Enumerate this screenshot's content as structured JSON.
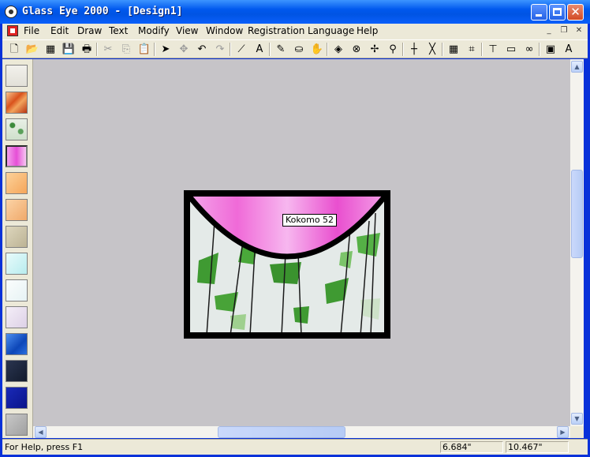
{
  "window": {
    "title": "Glass Eye 2000 - [Design1]"
  },
  "menu": {
    "items": [
      "File",
      "Edit",
      "Draw",
      "Text",
      "Modify",
      "View",
      "Window",
      "Registration",
      "Language",
      "Help"
    ]
  },
  "toolbar": {
    "tools": [
      {
        "name": "new-icon",
        "glyph": "🗋",
        "enabled": true
      },
      {
        "name": "open-icon",
        "glyph": "📂",
        "enabled": true
      },
      {
        "name": "grid-design-icon",
        "glyph": "▦",
        "enabled": true
      },
      {
        "name": "save-icon",
        "glyph": "💾",
        "enabled": true
      },
      {
        "name": "print-icon",
        "glyph": "🖶",
        "enabled": true
      },
      {
        "name": "cut-icon",
        "glyph": "✂",
        "enabled": false
      },
      {
        "name": "copy-icon",
        "glyph": "⎘",
        "enabled": false
      },
      {
        "name": "paste-icon",
        "glyph": "📋",
        "enabled": false
      },
      {
        "name": "select-icon",
        "glyph": "➤",
        "enabled": true
      },
      {
        "name": "pan-icon",
        "glyph": "✥",
        "enabled": false
      },
      {
        "name": "undo-icon",
        "glyph": "↶",
        "enabled": true
      },
      {
        "name": "redo-icon",
        "glyph": "↷",
        "enabled": false
      },
      {
        "name": "draw-curve-icon",
        "glyph": "⟋",
        "enabled": true
      },
      {
        "name": "text-icon",
        "glyph": "A",
        "enabled": true
      },
      {
        "name": "pencil-icon",
        "glyph": "✎",
        "enabled": true
      },
      {
        "name": "stamp-icon",
        "glyph": "⛀",
        "enabled": true
      },
      {
        "name": "hand-icon",
        "glyph": "✋",
        "enabled": true
      },
      {
        "name": "fill-icon",
        "glyph": "◈",
        "enabled": true
      },
      {
        "name": "center-icon",
        "glyph": "⊗",
        "enabled": true
      },
      {
        "name": "move-icon",
        "glyph": "✢",
        "enabled": true
      },
      {
        "name": "zoom-icon",
        "glyph": "⚲",
        "enabled": true
      },
      {
        "name": "crosshair-icon",
        "glyph": "┼",
        "enabled": true
      },
      {
        "name": "cross-icon",
        "glyph": "╳",
        "enabled": true
      },
      {
        "name": "grid-icon",
        "glyph": "▦",
        "enabled": true
      },
      {
        "name": "snap-grid-icon",
        "glyph": "⌗",
        "enabled": true
      },
      {
        "name": "dimension-icon",
        "glyph": "⊤",
        "enabled": true
      },
      {
        "name": "ruler-icon",
        "glyph": "▭",
        "enabled": true
      },
      {
        "name": "link-icon",
        "glyph": "∞",
        "enabled": true
      },
      {
        "name": "pattern-icon",
        "glyph": "▣",
        "enabled": true
      },
      {
        "name": "abc-icon",
        "glyph": "A",
        "enabled": true
      }
    ]
  },
  "palette": {
    "swatches": [
      {
        "name": "swatch-clear",
        "css": "linear-gradient(#f2f1ec,#e2e0d8)",
        "selected": false
      },
      {
        "name": "swatch-orange-streaky",
        "css": "linear-gradient(135deg,#f7c38c,#d9521c 40%,#f2a35c 60%,#b83312)",
        "selected": false
      },
      {
        "name": "swatch-green-fracture",
        "css": "radial-gradient(circle at 30% 30%,#3c8a3c 0 3px,transparent 4px),radial-gradient(circle at 70% 60%,#5aa05a 0 3px,transparent 4px),linear-gradient(#e8efe6,#cfe0cc)",
        "selected": false
      },
      {
        "name": "swatch-pink",
        "css": "linear-gradient(90deg,#f2a0ec,#e64fd6 50%,#f7c7f2)",
        "selected": true
      },
      {
        "name": "swatch-light-orange",
        "css": "linear-gradient(135deg,#fcd29a,#f5a65a)",
        "selected": false
      },
      {
        "name": "swatch-peach",
        "css": "linear-gradient(135deg,#fbd3a6,#f0a96a)",
        "selected": false
      },
      {
        "name": "swatch-tan",
        "css": "linear-gradient(135deg,#ddd6bd,#bcb394)",
        "selected": false
      },
      {
        "name": "swatch-aqua",
        "css": "linear-gradient(135deg,#e8fbfb,#b8ecee)",
        "selected": false
      },
      {
        "name": "swatch-white",
        "css": "linear-gradient(135deg,#fbfdfd,#e6f2f4)",
        "selected": false
      },
      {
        "name": "swatch-lavender",
        "css": "linear-gradient(135deg,#f4eef8,#ddd1e6)",
        "selected": false
      },
      {
        "name": "swatch-blue",
        "css": "linear-gradient(135deg,#4d8ff0,#0d47b8 60%,#2c70e0)",
        "selected": false
      },
      {
        "name": "swatch-dark-navy",
        "css": "linear-gradient(135deg,#2a3550,#121a2c)",
        "selected": false
      },
      {
        "name": "swatch-cobalt",
        "css": "linear-gradient(135deg,#1a2ab8,#0a148a)",
        "selected": false
      },
      {
        "name": "swatch-grey",
        "css": "linear-gradient(135deg,#c8c8c8,#a0a0a0)",
        "selected": false
      }
    ]
  },
  "design": {
    "tooltip": "Kokomo 52",
    "colors": {
      "lead": "#000000",
      "pink": "#f06ad8",
      "glass": "#dfe6e4",
      "green": "#3f9a32"
    }
  },
  "status": {
    "help": "For Help, press F1",
    "x": "6.684\"",
    "y": "10.467\""
  }
}
